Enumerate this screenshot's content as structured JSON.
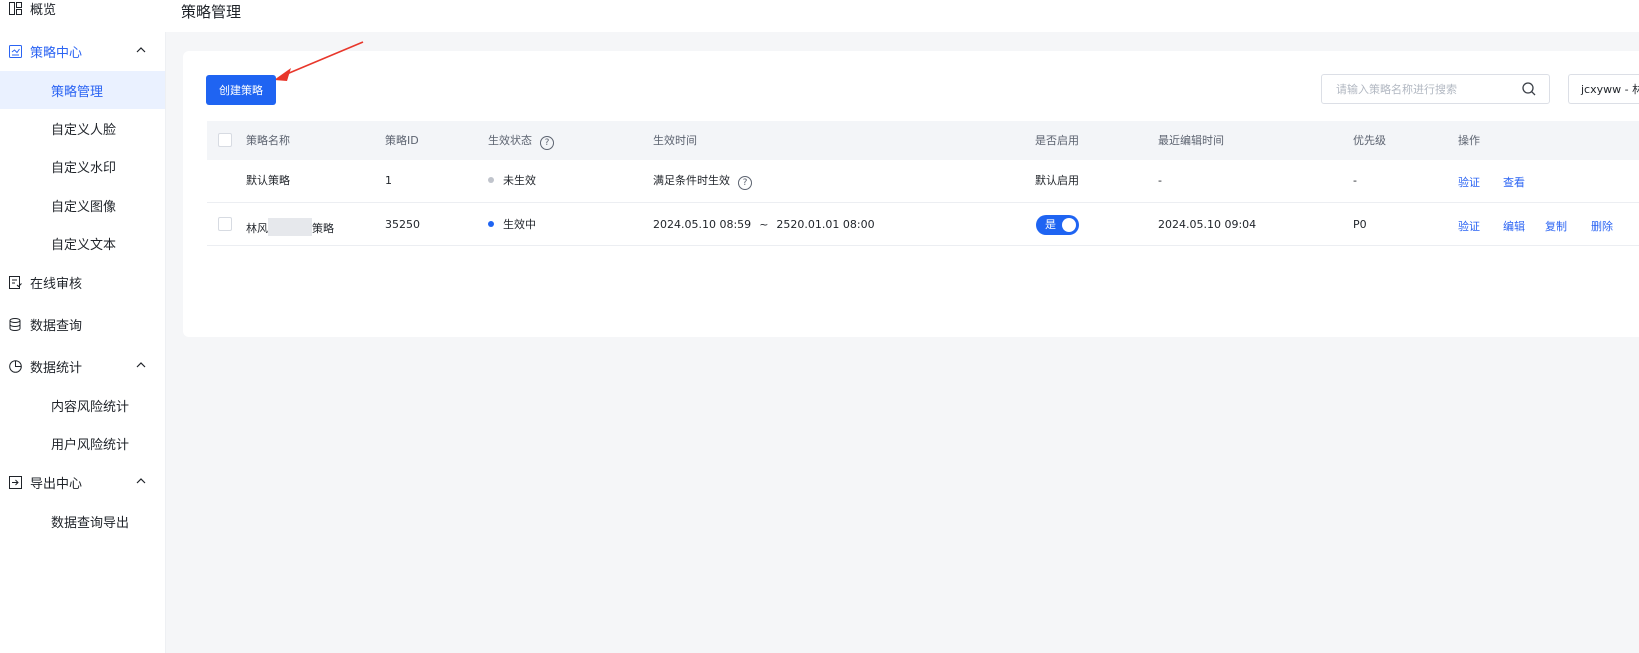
{
  "colors": {
    "accent": "#1f64f2",
    "active_bg": "#eaf1ff",
    "dot_inactive": "#c0c4cc",
    "dot_active": "#1f64f2"
  },
  "sidebar": {
    "overview": {
      "label": "概览",
      "icon": "overview-icon"
    },
    "strategy_center": {
      "label": "策略中心",
      "icon": "strategy-icon",
      "expanded": true
    },
    "strategy_items": [
      {
        "label": "策略管理",
        "active": true
      },
      {
        "label": "自定义人脸"
      },
      {
        "label": "自定义水印"
      },
      {
        "label": "自定义图像"
      },
      {
        "label": "自定义文本"
      }
    ],
    "online_review": {
      "label": "在线审核",
      "icon": "review-icon"
    },
    "data_query": {
      "label": "数据查询",
      "icon": "database-icon"
    },
    "data_stats": {
      "label": "数据统计",
      "icon": "pie-chart-icon",
      "expanded": true
    },
    "stats_items": [
      {
        "label": "内容风险统计"
      },
      {
        "label": "用户风险统计"
      }
    ],
    "export_center": {
      "label": "导出中心",
      "icon": "export-icon",
      "expanded": true
    },
    "export_items": [
      {
        "label": "数据查询导出"
      }
    ]
  },
  "header": {
    "title": "策略管理"
  },
  "toolbar": {
    "create_label": "创建策略",
    "search_placeholder": "请输入策略名称进行搜索",
    "account_value": "jcxyww - 林"
  },
  "table": {
    "columns": [
      "策略名称",
      "策略ID",
      "生效状态",
      "生效时间",
      "是否启用",
      "最近编辑时间",
      "优先级",
      "操作"
    ],
    "rows": [
      {
        "name": "默认策略",
        "id": "1",
        "status": "未生效",
        "status_active": false,
        "time": "满足条件时生效",
        "enabled_text": "默认启用",
        "edited": "-",
        "priority": "-",
        "actions": [
          "验证",
          "查看"
        ]
      },
      {
        "name_prefix": "林风",
        "name_suffix": "策略",
        "id": "35250",
        "status": "生效中",
        "status_active": true,
        "time_start": "2024.05.10 08:59",
        "time_sep": "~",
        "time_end": "2520.01.01 08:00",
        "toggle_label": "是",
        "toggle_on": true,
        "edited": "2024.05.10 09:04",
        "priority": "P0",
        "actions": [
          "验证",
          "编辑",
          "复制",
          "删除"
        ]
      }
    ]
  }
}
